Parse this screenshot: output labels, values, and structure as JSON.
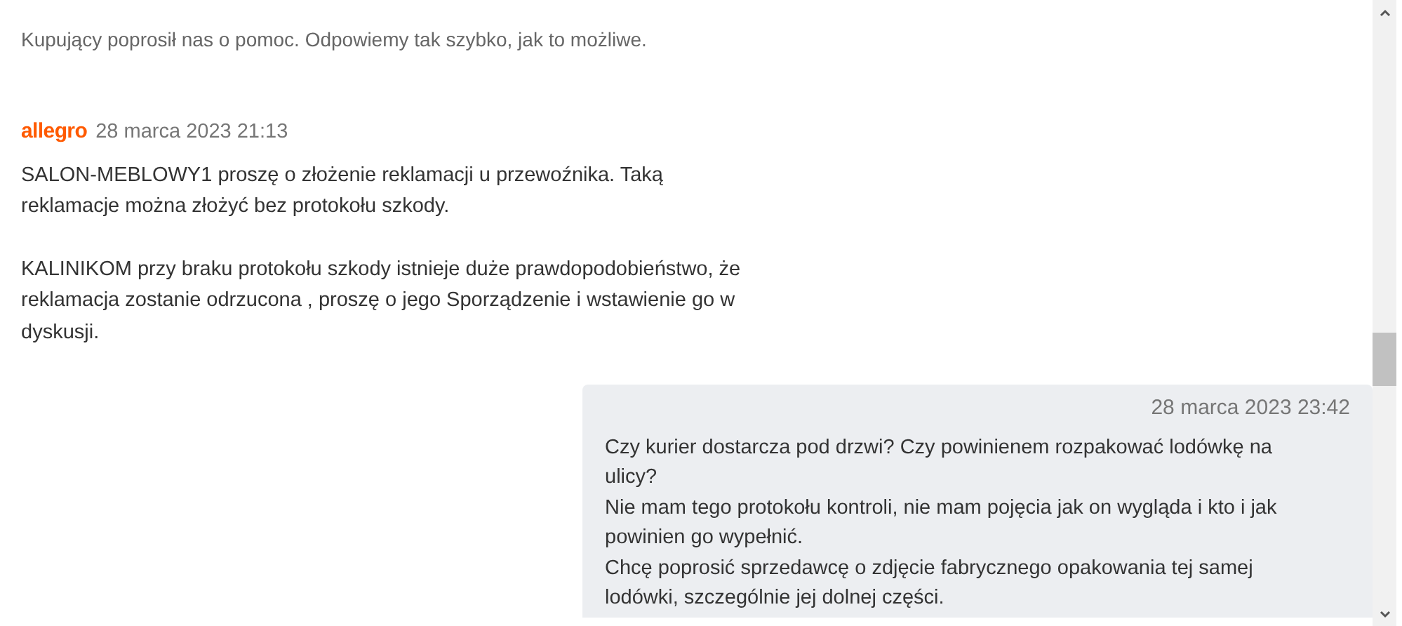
{
  "messages": [
    {
      "kind": "system",
      "text": "Kupujący poprosił nas o pomoc. Odpowiemy tak szybko, jak to możliwe."
    },
    {
      "kind": "allegro",
      "author": "allegro",
      "time": "28 marca 2023 21:13",
      "paragraphs": [
        "SALON-MEBLOWY1 proszę o złożenie reklamacji u przewoźnika. Taką reklamacje można złożyć bez protokołu szkody.",
        "KALINIKOM przy braku protokołu szkody istnieje duże prawdopodobieństwo, że reklamacja zostanie odrzucona , proszę o jego Sporządzenie i wstawienie go w dyskusji."
      ]
    },
    {
      "kind": "own",
      "time": "28 marca 2023 23:42",
      "lines": [
        "Czy kurier dostarcza pod drzwi? Czy powinienem rozpakować lodówkę na ulicy?",
        "Nie mam tego protokołu kontroli, nie mam pojęcia jak on wygląda i kto i jak powinien go wypełnić.",
        "Chcę poprosić sprzedawcę o zdjęcie fabrycznego opakowania tej samej lodówki, szczególnie jej dolnej części."
      ]
    }
  ]
}
